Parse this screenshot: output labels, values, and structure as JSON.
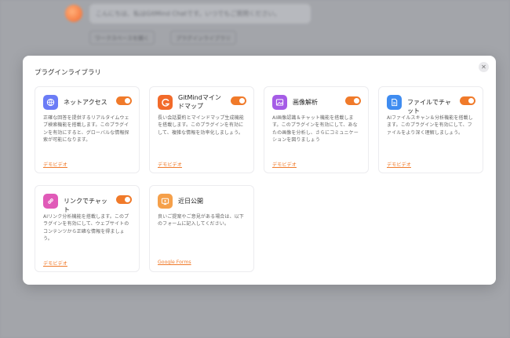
{
  "background": {
    "chat_text": "こんにちは、私はGitMind Chatです。いつでもご質問ください。",
    "buttons": [
      "ワークスペースを開く",
      "プラグインライブラリ"
    ]
  },
  "modal": {
    "title": "プラグインライブラリ",
    "close_glyph": "✕"
  },
  "plugins": [
    {
      "name": "ネットアクセス",
      "enabled": true,
      "icon": "globe-icon",
      "icon_color": "#6b7cf6",
      "description": "正確な回答を提供するリアルタイムウェブ検索機能を搭載します。このプラグインを有効にすると、グローバルな情報探索が可能になります。",
      "link": "デモビデオ"
    },
    {
      "name": "GitMindマインドマップ",
      "enabled": true,
      "icon": "gitmind-logo-icon",
      "icon_color": "#f26a2a",
      "description": "長い会話要約とマインドマップ生成機能を搭載します。このプラグインを有効にして、複雑な情報を効率化しましょう。",
      "link": "デモビデオ"
    },
    {
      "name": "画像解析",
      "enabled": true,
      "icon": "image-icon",
      "icon_color": "#a55ce6",
      "description": "AI画像認識＆チャット機能を搭載します。このプラグインを有効にして、あなたの画像を分析し、さらにコミュニケーションを図りましょう",
      "link": "デモビデオ"
    },
    {
      "name": "ファイルでチャット",
      "enabled": true,
      "icon": "document-icon",
      "icon_color": "#3f8cf0",
      "description": "AIファイルスキャン＆分析機能を搭載します。このプラグインを有効にして、ファイルをより深く理解しましょう。",
      "link": "デモビデオ"
    },
    {
      "name": "リンクでチャット",
      "enabled": true,
      "icon": "link-icon",
      "icon_color": "#e05ab8",
      "description": "AIリンク分析機能を搭載します。このプラグインを有効にして、ウェブサイトのコンテンツから正確な情報を得ましょう。",
      "link": "デモビデオ"
    },
    {
      "name": "近日公開",
      "icon": "coming-soon-icon",
      "icon_color": "#f5a04a",
      "description": "良いご提案やご意見がある場合は、以下のフォームに記入してください。",
      "link": "Google Forms"
    }
  ]
}
